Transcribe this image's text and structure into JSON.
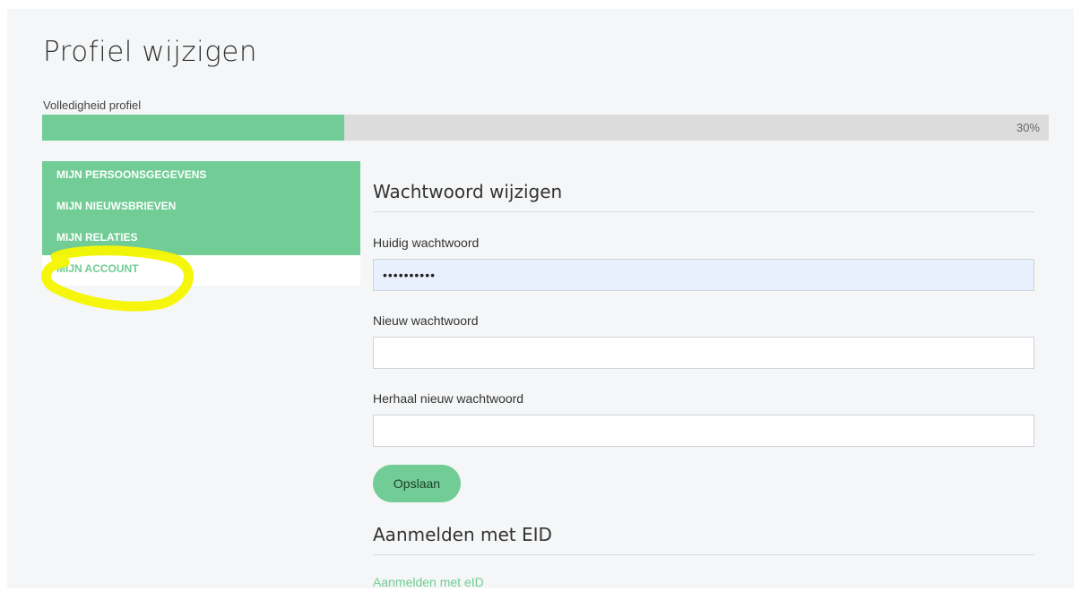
{
  "page": {
    "title": "Profiel wijzigen"
  },
  "progress": {
    "label": "Volledigheid profiel",
    "value": 0.3,
    "text": "30%",
    "fill_color": "#71cc95",
    "track_color": "#dcdcdc"
  },
  "side_nav": {
    "items": [
      {
        "label": "MIJN PERSOONSGEGEVENS",
        "active": false
      },
      {
        "label": "MIJN NIEUWSBRIEVEN",
        "active": false
      },
      {
        "label": "MIJN RELATIES",
        "active": false
      },
      {
        "label": "MIJN ACCOUNT",
        "active": true
      }
    ],
    "highlight_color": "#f5f500"
  },
  "password_section": {
    "title": "Wachtwoord wijzigen",
    "current": {
      "label": "Huidig wachtwoord",
      "value": "••••••••••"
    },
    "new": {
      "label": "Nieuw wachtwoord",
      "value": ""
    },
    "repeat": {
      "label": "Herhaal nieuw wachtwoord",
      "value": ""
    },
    "save_label": "Opslaan"
  },
  "eid_section": {
    "title": "Aanmelden met EID",
    "link_label": "Aanmelden met eID"
  },
  "colors": {
    "accent": "#71cc95",
    "panel_bg": "#f5f6f7"
  }
}
